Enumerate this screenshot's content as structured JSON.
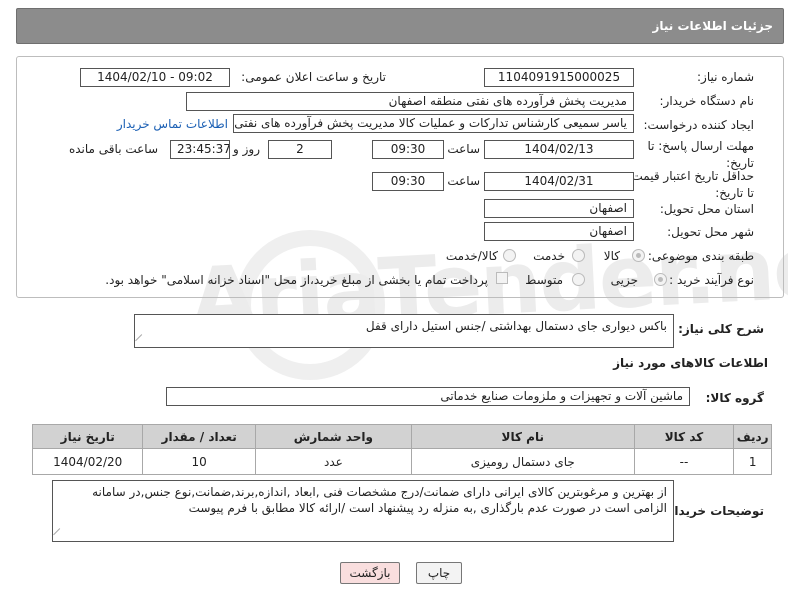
{
  "header": {
    "title": "جزئیات اطلاعات نیاز"
  },
  "form": {
    "need_number_label": "شماره نیاز:",
    "need_number": "1104091915000025",
    "announce_label": "تاریخ و ساعت اعلان عمومی:",
    "announce_value": "1404/02/10 - 09:02",
    "buyer_org_label": "نام دستگاه خریدار:",
    "buyer_org": "مدیریت پخش فرآورده های نفتی منطقه اصفهان",
    "creator_label": "ایجاد کننده درخواست:",
    "creator": "یاسر  سمیعی کارشناس تدارکات و عملیات کالا مدیریت پخش فرآورده های نفتی",
    "buyer_contact_link": "اطلاعات تماس خریدار",
    "reply_deadline_label": "مهلت ارسال پاسخ: تا تاریخ:",
    "reply_date": "1404/02/13",
    "time_label": "ساعت",
    "reply_time": "09:30",
    "days_value": "2",
    "days_label": "روز و",
    "remaining_time": "23:45:37",
    "remaining_label": "ساعت باقی مانده",
    "min_price_label": "حداقل تاریخ اعتبار قیمت: تا تاریخ:",
    "price_date": "1404/02/31",
    "price_time": "09:30",
    "province_label": "استان محل تحویل:",
    "province": "اصفهان",
    "city_label": "شهر محل تحویل:",
    "city": "اصفهان",
    "category_label": "طبقه بندی موضوعی:",
    "cat_goods": "کالا",
    "cat_service": "خدمت",
    "cat_goods_service": "کالا/خدمت",
    "process_label": "نوع فرآیند خرید :",
    "proc_partial": "جزیی",
    "proc_medium": "متوسط",
    "payment_note": "پرداخت تمام یا بخشی از مبلغ خرید،از محل \"اسناد خزانه اسلامی\" خواهد بود."
  },
  "description": {
    "label": "شرح کلی نیاز:",
    "text": "باکس دیواری جای دستمال بهداشتی /جنس استیل دارای قفل"
  },
  "goods_info": {
    "title": "اطلاعات کالاهای مورد نیاز",
    "group_label": "گروه کالا:",
    "group": "ماشین آلات و تجهیزات و ملزومات صنایع خدماتی"
  },
  "table": {
    "headers": [
      "ردیف",
      "کد کالا",
      "نام کالا",
      "واحد شمارش",
      "تعداد / مقدار",
      "تاریخ نیاز"
    ],
    "rows": [
      [
        "1",
        "--",
        "جای دستمال رومیزی",
        "عدد",
        "10",
        "1404/02/20"
      ]
    ]
  },
  "buyer_notes": {
    "label": "توضیحات خریدار:",
    "text": "از بهترین و مرغوبترین کالای ایرانی دارای ضمانت/درج مشخصات فنی ,ابعاد ,اندازه,برند,ضمانت,نوع جنس,در سامانه الزامی است در صورت عدم بارگذاری ,به منزله رد پیشنهاد است /ارائه کالا مطابق با فرم پیوست"
  },
  "buttons": {
    "print": "چاپ",
    "back": "بازگشت"
  },
  "watermark": {
    "brand": "AriaTender.neT"
  },
  "colors": {
    "header_bg": "#8c8c8c",
    "table_header_bg": "#d2d2d2",
    "link": "#1a5fb4",
    "back_btn_bg": "#f9dede"
  }
}
